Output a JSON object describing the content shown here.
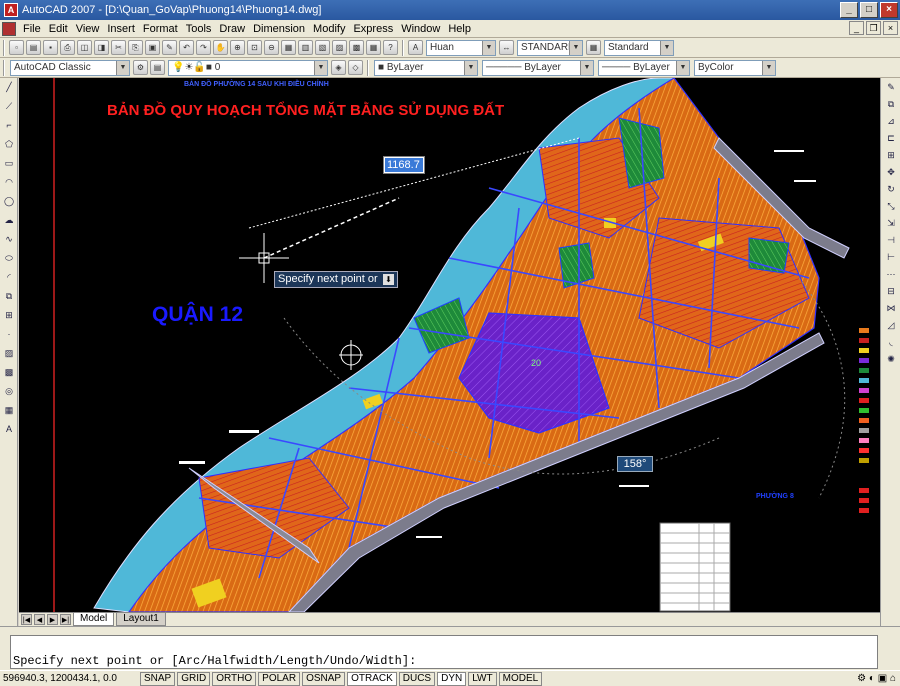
{
  "window": {
    "title": "AutoCAD 2007 - [D:\\Quan_GoVap\\Phuong14\\Phuong14.dwg]"
  },
  "menu": [
    "File",
    "Edit",
    "View",
    "Insert",
    "Format",
    "Tools",
    "Draw",
    "Dimension",
    "Modify",
    "Express",
    "Window",
    "Help"
  ],
  "toolbar": {
    "text_style": "Huan",
    "dim_style": "STANDARD",
    "table_style": "Standard",
    "workspace": "AutoCAD Classic",
    "layer": "0",
    "color": "ByLayer",
    "linetype": "ByLayer",
    "lineweight": "ByLayer",
    "plotstyle": "ByColor"
  },
  "drawing": {
    "header_small": "BẢN ĐỒ PHƯỜNG 14 SAU KHI ĐIỀU CHỈNH",
    "title": "BẢN ĐỒ QUY HOẠCH TỔNG MẶT BẰNG SỬ DỤNG ĐẤT",
    "district_label": "QUẬN 12",
    "ward_label": "PHƯỜNG 8",
    "dim_length": "1168.7",
    "dim_angle": "158°",
    "tooltip": "Specify next point or",
    "block_number": "20"
  },
  "layout_tabs": [
    "Model",
    "Layout1"
  ],
  "command": {
    "line": "Specify next point or [Arc/Halfwidth/Length/Undo/Width]:"
  },
  "status": {
    "coords": "596940.3, 1200434.1, 0.0",
    "buttons": [
      "SNAP",
      "GRID",
      "ORTHO",
      "POLAR",
      "OSNAP",
      "OTRACK",
      "DUCS",
      "DYN",
      "LWT",
      "MODEL"
    ]
  },
  "colors": {
    "titlebar": "#2a58a0",
    "canvas_bg": "#000000",
    "title_red": "#ff2020",
    "district_blue": "#1a1aff",
    "residential_orange": "#e87a1c",
    "river_cyan": "#4fb8d8",
    "public_purple": "#7a2ad8",
    "road_grey": "#8a8a96"
  }
}
